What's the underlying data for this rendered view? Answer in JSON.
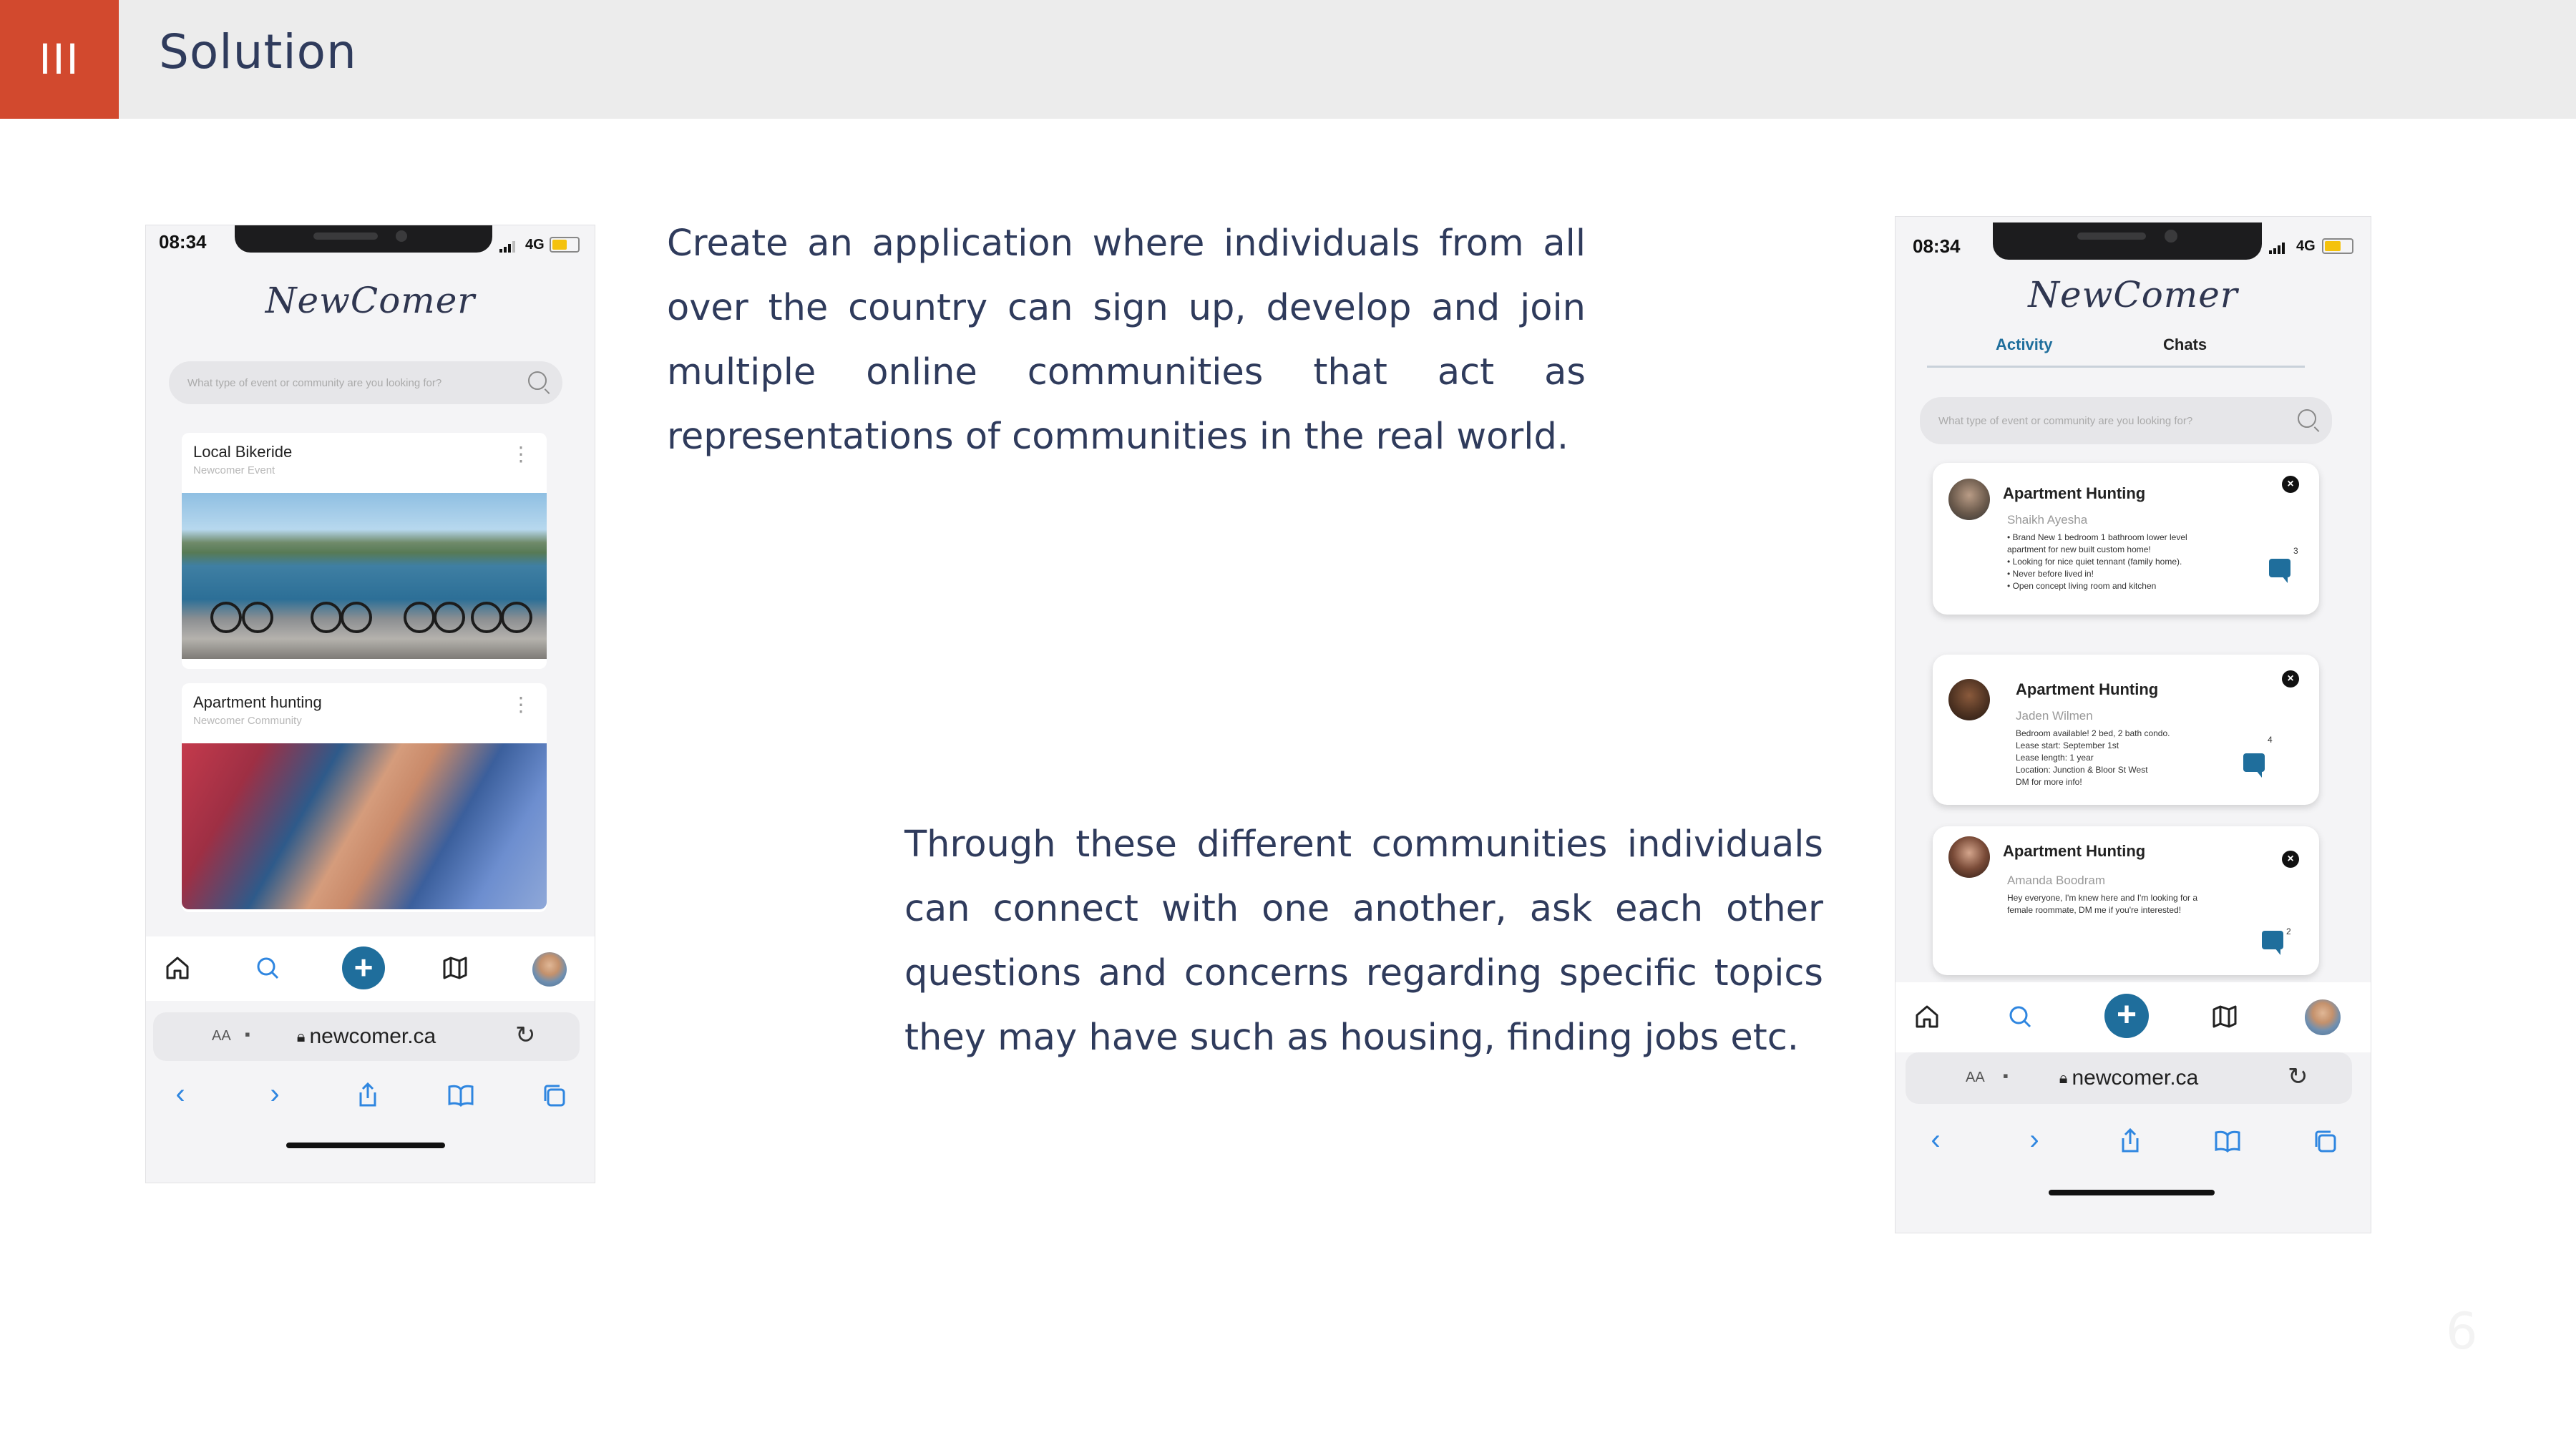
{
  "slide": {
    "section_number": "III",
    "title": "Solution",
    "paragraph_1": "Create an application where individuals from all over the country can sign up, develop and join multiple online communities that act as representations of communities in the real world.",
    "paragraph_2": "Through these different communities individuals can connect with one another, ask each other questions and concerns regarding specific topics they may have such as housing, finding jobs etc.",
    "page_number": "6"
  },
  "phone_left": {
    "status": {
      "time": "08:34",
      "network": "4G"
    },
    "app_logo": "NewComer",
    "search_placeholder": "What type of event or community are you looking for?",
    "cards": [
      {
        "title": "Local Bikeride",
        "subtitle": "Newcomer Event"
      },
      {
        "title": "Apartment hunting",
        "subtitle": "Newcomer Community"
      }
    ],
    "browser": {
      "aa": "AA",
      "url": "newcomer.ca"
    }
  },
  "phone_right": {
    "status": {
      "time": "08:34",
      "network": "4G"
    },
    "app_logo": "NewComer",
    "tabs": [
      "Activity",
      "Chats"
    ],
    "search_placeholder": "What type of event or community are you looking for?",
    "posts": [
      {
        "title": "Apartment Hunting",
        "author": "Shaikh Ayesha",
        "body": "• Brand New 1 bedroom 1 bathroom lower level\n  apartment for new built custom home!\n• Looking for nice quiet tennant (family home).\n• Never before lived in!\n• Open concept living room and kitchen",
        "comments": "3"
      },
      {
        "title": "Apartment Hunting",
        "author": "Jaden Wilmen",
        "body": "Bedroom available! 2 bed, 2 bath condo.\nLease start: September 1st\nLease length: 1 year\nLocation: Junction & Bloor St West\nDM for more info!",
        "comments": "4"
      },
      {
        "title": "Apartment Hunting",
        "author": "Amanda Boodram",
        "body": "Hey everyone, I'm knew here and I'm looking for a\nfemale roommate, DM me if you're interested!",
        "comments": "2"
      }
    ],
    "browser": {
      "aa": "AA",
      "url": "newcomer.ca"
    }
  },
  "colors": {
    "accent": "#d2492e",
    "header_bg": "#ececec",
    "text": "#2f3b5c",
    "app_blue": "#1f6e9c",
    "link_blue": "#2f86e0"
  },
  "icons": [
    "home-icon",
    "search-icon",
    "plus-icon",
    "map-icon",
    "avatar",
    "lock-icon",
    "reload-icon",
    "back-icon",
    "forward-icon",
    "share-icon",
    "bookmarks-icon",
    "tabs-icon",
    "close-icon",
    "chat-icon",
    "kebab-icon"
  ]
}
